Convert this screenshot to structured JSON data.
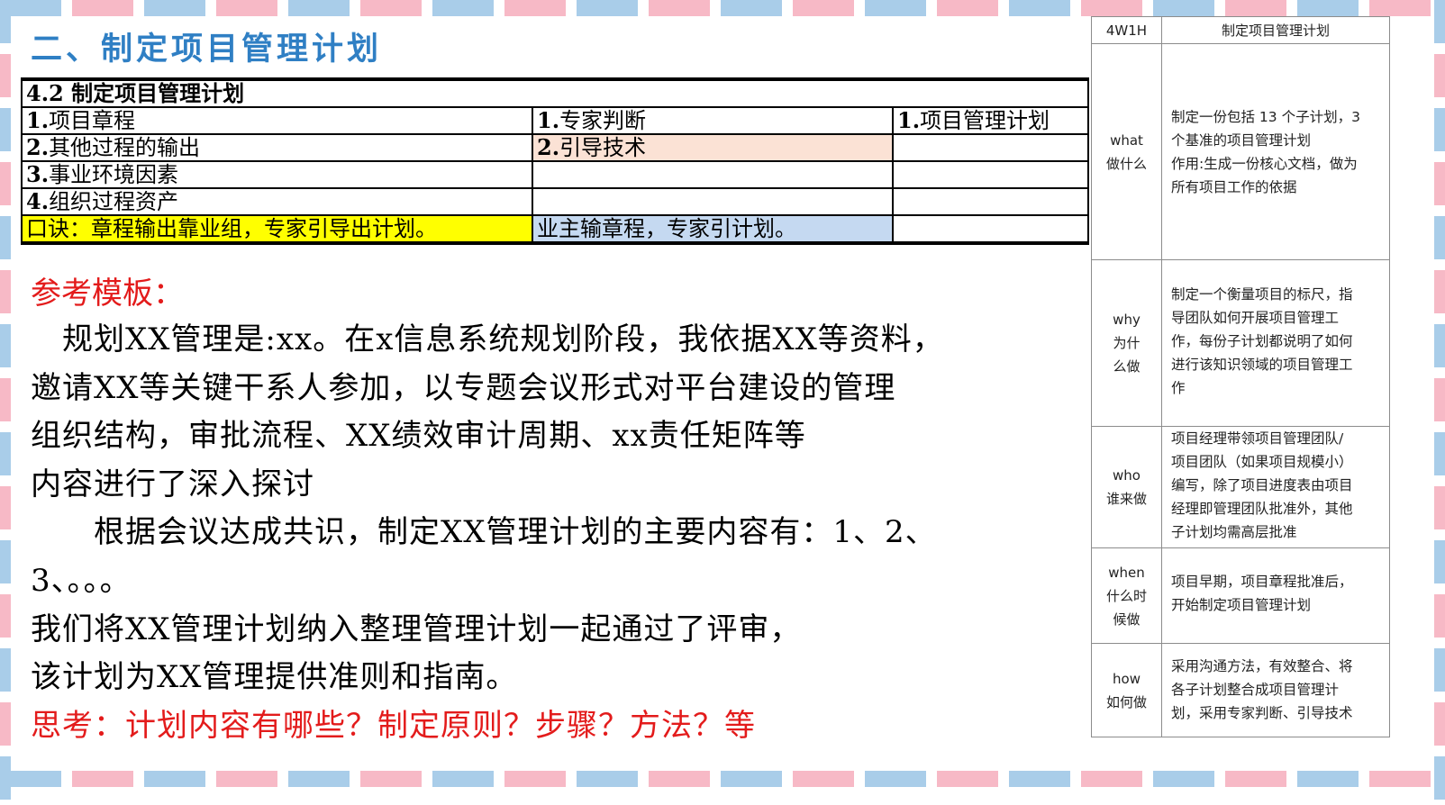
{
  "section_title": "二、制定项目管理计划",
  "process_table": {
    "heading": "4.2 制定项目管理计划",
    "rows": [
      {
        "input_num": "1.",
        "input": "项目章程",
        "tool_num": "1.",
        "tool": "专家判断",
        "output_num": "1.",
        "output": "项目管理计划"
      },
      {
        "input_num": "2.",
        "input": "其他过程的输出",
        "tool_num": "2.",
        "tool": "引导技术",
        "output_num": "",
        "output": ""
      },
      {
        "input_num": "3.",
        "input": "事业环境因素",
        "tool_num": "",
        "tool": "",
        "output_num": "",
        "output": ""
      },
      {
        "input_num": "4.",
        "input": "组织过程资产",
        "tool_num": "",
        "tool": "",
        "output_num": "",
        "output": ""
      }
    ],
    "mnemonic_1": "口诀：章程输出靠业组，专家引导出计划。",
    "mnemonic_2": "业主输章程，专家引计划。",
    "mnemonic_3": ""
  },
  "template": {
    "heading": "参考模板：",
    "lines": [
      "　规划XX管理是:xx。在x信息系统规划阶段，我依据XX等资料，",
      "邀请XX等关键干系人参加，以专题会议形式对平台建设的管理",
      "组织结构，审批流程、XX绩效审计周期、xx责任矩阵等",
      "内容进行了深入探讨",
      "　　根据会议达成共识，制定XX管理计划的主要内容有：1、2、",
      "3、。。。",
      "我们将XX管理计划纳入整理管理计划一起通过了评审，",
      "该计划为XX管理提供准则和指南。"
    ],
    "think": "思考：计划内容有哪些？制定原则？步骤？方法？等"
  },
  "w4h1": {
    "header_key": "4W1H",
    "header_value": "制定项目管理计划",
    "rows": [
      {
        "key_en": "what",
        "key_cn": [
          "做什么"
        ],
        "value": [
          "制定一份包括 13 个子计划，3",
          "个基准的项目管理计划",
          "作用:生成一份核心文档，做为",
          "所有项目工作的依据"
        ]
      },
      {
        "key_en": "why",
        "key_cn": [
          "为什",
          "么做"
        ],
        "value": [
          "制定一个衡量项目的标尺，指",
          "导团队如何开展项目管理工",
          "作，每份子计划都说明了如何",
          "进行该知识领域的项目管理工",
          "作"
        ]
      },
      {
        "key_en": "who",
        "key_cn": [
          "谁来做"
        ],
        "value": [
          "项目经理带领项目管理团队/",
          "项目团队（如果项目规模小）",
          "编写，除了项目进度表由项目",
          "经理即管理团队批准外，其他",
          "子计划均需高层批准"
        ]
      },
      {
        "key_en": "when",
        "key_cn": [
          "什么时",
          "候做"
        ],
        "value": [
          "项目早期，项目章程批准后，",
          "开始制定项目管理计划"
        ]
      },
      {
        "key_en": "how",
        "key_cn": [
          "如何做"
        ],
        "value": [
          "采用沟通方法，有效整合、将",
          "各子计划整合成项目管理计",
          "划，采用专家判断、引导技术"
        ]
      }
    ]
  }
}
